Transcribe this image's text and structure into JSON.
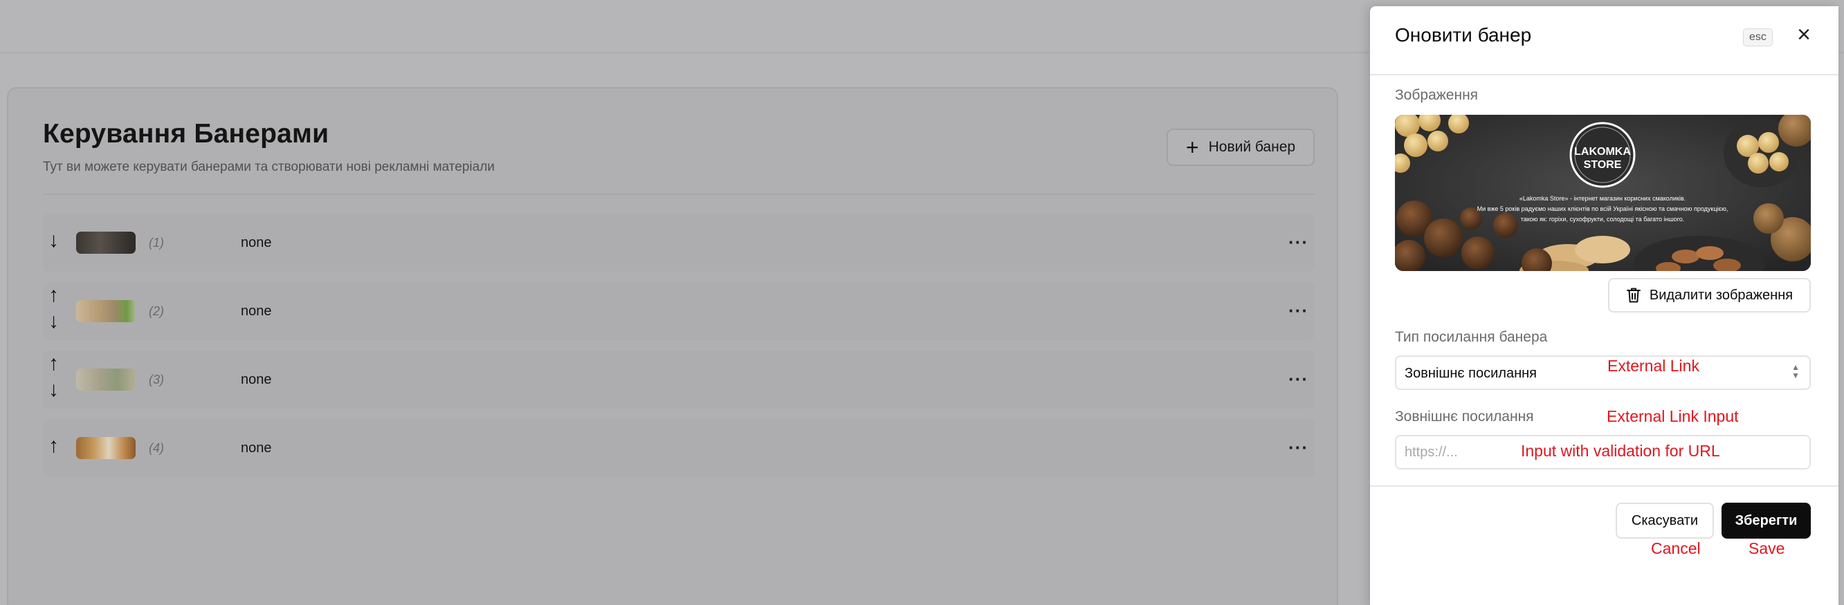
{
  "page": {
    "title": "Керування Банерами",
    "subtitle": "Тут ви можете керувати банерами та створювати нові рекламні матеріали",
    "new_banner_label": "Новий банер",
    "rows": [
      {
        "index": "(1)",
        "value": "none"
      },
      {
        "index": "(2)",
        "value": "none"
      },
      {
        "index": "(3)",
        "value": "none"
      },
      {
        "index": "(4)",
        "value": "none"
      }
    ]
  },
  "drawer": {
    "title": "Оновити банер",
    "esc_label": "esc",
    "image_label": "Зображення",
    "image": {
      "brand_line1": "LAKOMKA",
      "brand_line2": "STORE",
      "caption1": "«Lakomka Store» - інтернет магазин корисних смаколиків.",
      "caption2": "Ми вже 5 років радуємо наших клієнтів по всій Україні якісною та смачною продукцією,",
      "caption3": "такою як: горіхи, сухофрукти, солодощі та багато іншого."
    },
    "delete_image_label": "Видалити зображення",
    "link_type_label": "Тип посилання банера",
    "link_type_value": "Зовнішнє посилання",
    "external_link_label": "Зовнішнє посилання",
    "external_link_placeholder": "https://...",
    "external_link_value": "",
    "cancel_label": "Скасувати",
    "save_label": "Зберегти"
  },
  "annotations": {
    "external_link": "External Link",
    "external_link_input": "External Link Input",
    "input_validation": "Input with validation for URL",
    "cancel": "Cancel",
    "save": "Save"
  },
  "colors": {
    "overlay_bg": "#b6b6b8",
    "primary_button": "#0d0d0d",
    "annotation_red": "#e0161e"
  }
}
